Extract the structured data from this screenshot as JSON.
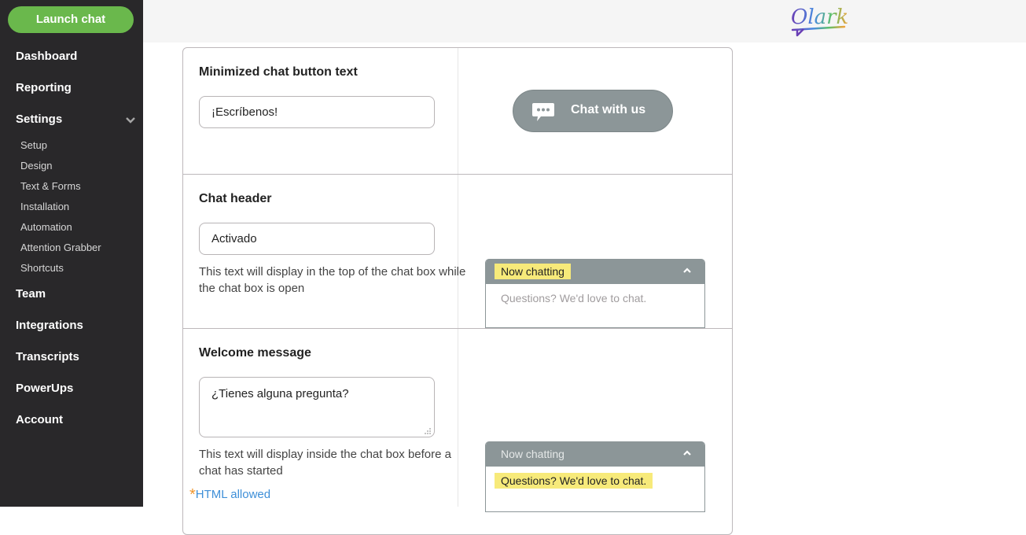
{
  "sidebar": {
    "launch_label": "Launch chat",
    "items": [
      {
        "label": "Dashboard"
      },
      {
        "label": "Reporting"
      },
      {
        "label": "Settings",
        "expanded": true
      },
      {
        "label": "Team"
      },
      {
        "label": "Integrations"
      },
      {
        "label": "Transcripts"
      },
      {
        "label": "PowerUps"
      },
      {
        "label": "Account"
      }
    ],
    "settings_sub": [
      {
        "label": "Setup"
      },
      {
        "label": "Design"
      },
      {
        "label": "Text & Forms"
      },
      {
        "label": "Installation"
      },
      {
        "label": "Automation"
      },
      {
        "label": "Attention Grabber"
      },
      {
        "label": "Shortcuts"
      }
    ]
  },
  "header": {
    "logo_text": "Olark"
  },
  "sections": {
    "minimized": {
      "title": "Minimized chat button text",
      "value": "¡Escríbenos!",
      "preview_label": "Chat with us"
    },
    "chat_header": {
      "title": "Chat header",
      "value": "Activado",
      "help": "This text will display in the top of the chat box while the chat box is open",
      "preview_title": "Now chatting",
      "preview_message": "Questions? We'd love to chat."
    },
    "welcome": {
      "title": "Welcome message",
      "value": "¿Tienes alguna pregunta?",
      "help": "This text will display inside the chat box before a chat has started",
      "html_note_star": "*",
      "html_note": "HTML allowed",
      "preview_title": "Now chatting",
      "preview_message": "Questions? We'd love to chat."
    }
  },
  "colors": {
    "sidebar_bg": "#29282a",
    "launch_green": "#6ab84c",
    "preview_gray": "#8c9698",
    "highlight_yellow": "#f7ea7a",
    "link_blue": "#3e8fd8",
    "star_orange": "#f0962e"
  }
}
